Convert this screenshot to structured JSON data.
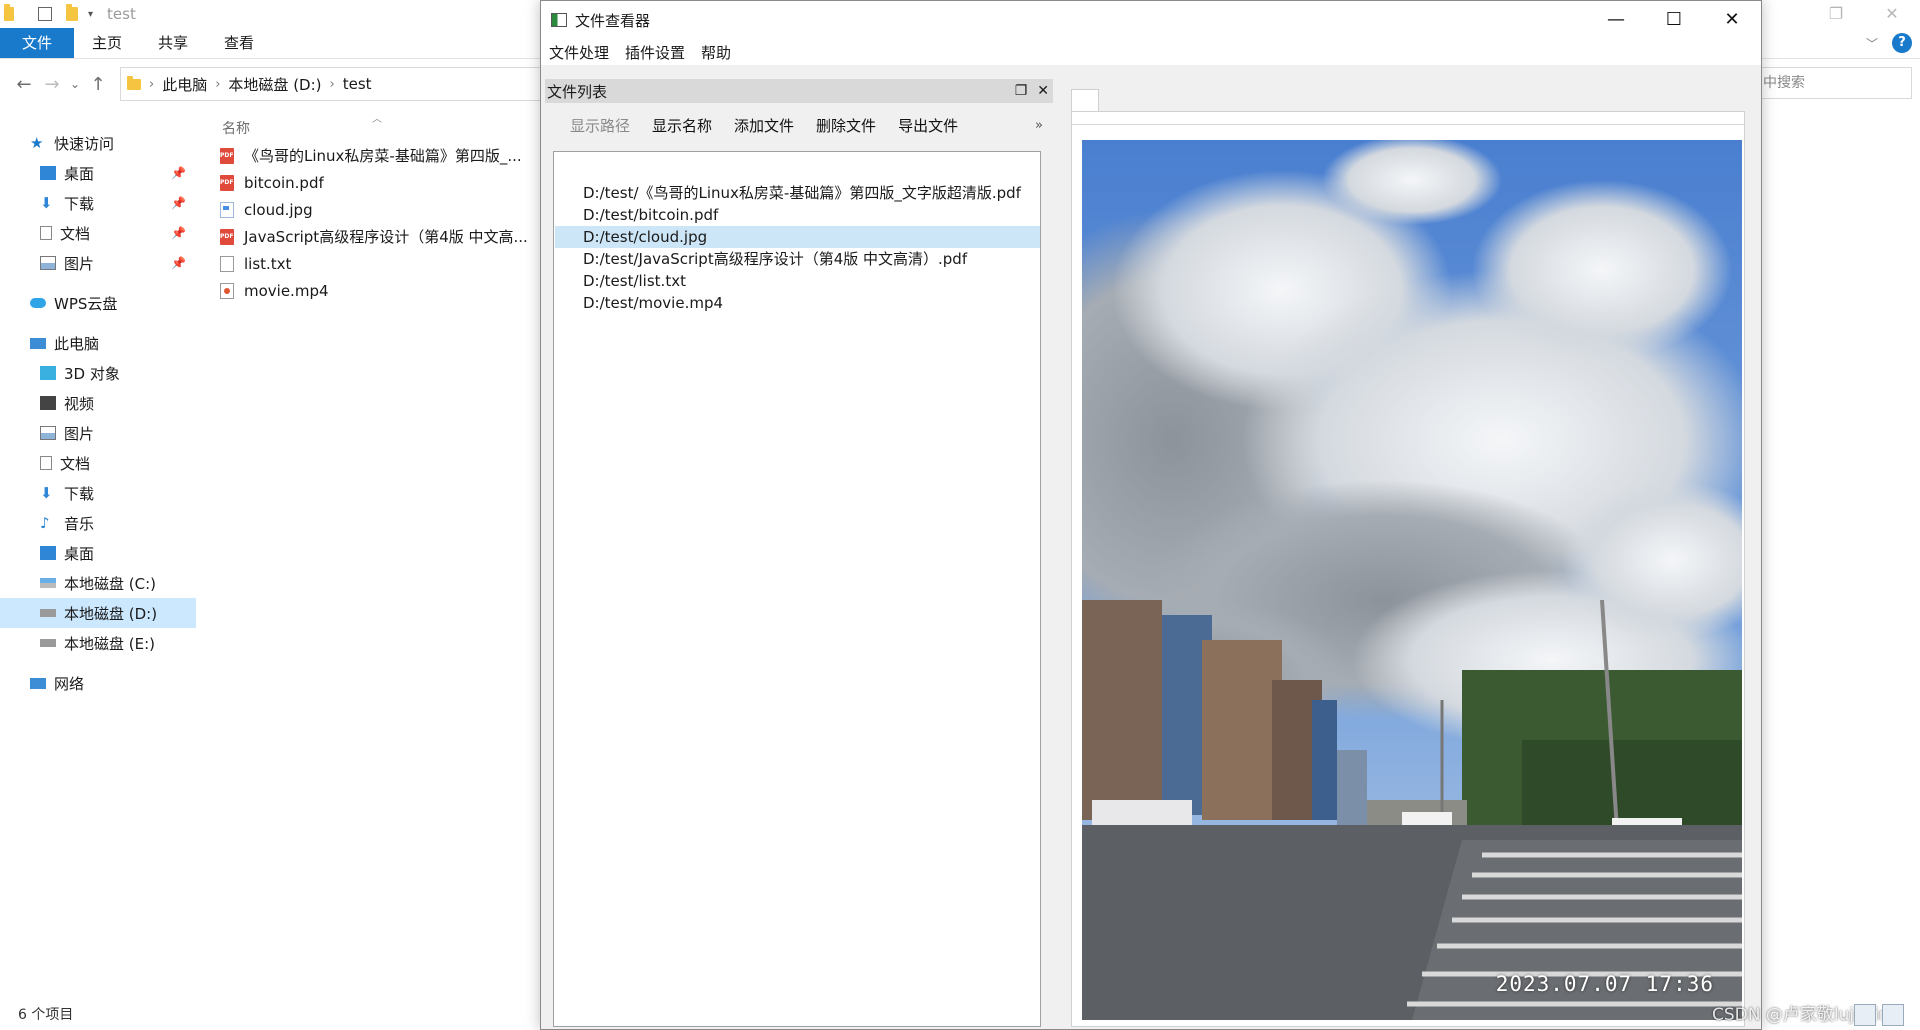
{
  "explorer": {
    "title": "test",
    "ribbon_tabs": [
      "文件",
      "主页",
      "共享",
      "查看"
    ],
    "breadcrumb": [
      "此电脑",
      "本地磁盘 (D:)",
      "test"
    ],
    "search_placeholder": "中搜索",
    "help_label": "?",
    "column_name": "名称",
    "nav": {
      "quick_access": "快速访问",
      "quick_items": [
        "桌面",
        "下载",
        "文档",
        "图片"
      ],
      "wps": "WPS云盘",
      "this_pc": "此电脑",
      "pc_items": [
        "3D 对象",
        "视频",
        "图片",
        "文档",
        "下载",
        "音乐",
        "桌面",
        "本地磁盘 (C:)",
        "本地磁盘 (D:)",
        "本地磁盘 (E:)"
      ],
      "network": "网络"
    },
    "files": [
      {
        "name": "《鸟哥的Linux私房菜-基础篇》第四版_...",
        "type": "pdf"
      },
      {
        "name": "bitcoin.pdf",
        "type": "pdf"
      },
      {
        "name": "cloud.jpg",
        "type": "img"
      },
      {
        "name": "JavaScript高级程序设计（第4版 中文高...",
        "type": "pdf"
      },
      {
        "name": "list.txt",
        "type": "txt"
      },
      {
        "name": "movie.mp4",
        "type": "vid"
      }
    ],
    "status": "6 个项目"
  },
  "viewer": {
    "title": "文件查看器",
    "menu": [
      "文件处理",
      "插件设置",
      "帮助"
    ],
    "dock_title": "文件列表",
    "toolbar": {
      "show_path": "显示路径",
      "show_name": "显示名称",
      "add_file": "添加文件",
      "delete_file": "删除文件",
      "export_file": "导出文件",
      "more": "»"
    },
    "list_items": [
      "D:/test/《鸟哥的Linux私房菜-基础篇》第四版_文字版超清版.pdf",
      "D:/test/bitcoin.pdf",
      "D:/test/cloud.jpg",
      "D:/test/JavaScript高级程序设计（第4版 中文高清）.pdf",
      "D:/test/list.txt",
      "D:/test/movie.mp4"
    ],
    "selected_index": 2,
    "photo_timestamp": "2023.07.07   17:36"
  },
  "watermark": "CSDN @卢家敬lujiajing",
  "colors": {
    "accent": "#1979ca",
    "selection": "#cde6f7",
    "nav_selection": "#cce8ff"
  }
}
